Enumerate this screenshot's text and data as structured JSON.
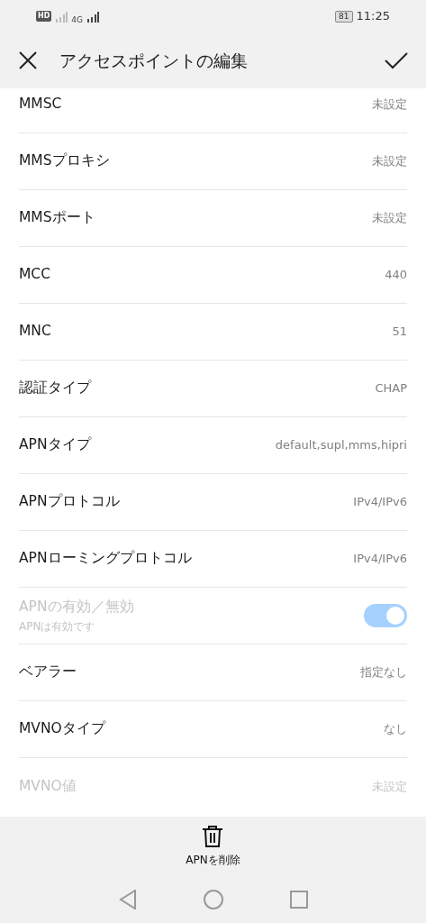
{
  "status_bar": {
    "hd_label": "HD",
    "network_label": "4G",
    "battery": "81",
    "time": "11:25"
  },
  "header": {
    "title": "アクセスポイントの編集"
  },
  "rows": [
    {
      "kind": "value",
      "label": "MMSC",
      "value": "未設定",
      "disabled": false
    },
    {
      "kind": "value",
      "label": "MMSプロキシ",
      "value": "未設定",
      "disabled": false
    },
    {
      "kind": "value",
      "label": "MMSポート",
      "value": "未設定",
      "disabled": false
    },
    {
      "kind": "value",
      "label": "MCC",
      "value": "440",
      "disabled": false
    },
    {
      "kind": "value",
      "label": "MNC",
      "value": "51",
      "disabled": false
    },
    {
      "kind": "value",
      "label": "認証タイプ",
      "value": "CHAP",
      "disabled": false
    },
    {
      "kind": "value",
      "label": "APNタイプ",
      "value": "default,supl,mms,hipri",
      "disabled": false
    },
    {
      "kind": "value",
      "label": "APNプロトコル",
      "value": "IPv4/IPv6",
      "disabled": false
    },
    {
      "kind": "value",
      "label": "APNローミングプロトコル",
      "value": "IPv4/IPv6",
      "disabled": false
    },
    {
      "kind": "toggle",
      "label": "APNの有効／無効",
      "summary": "APNは有効です",
      "on": true,
      "disabled": true
    },
    {
      "kind": "value",
      "label": "ベアラー",
      "value": "指定なし",
      "disabled": false
    },
    {
      "kind": "value",
      "label": "MVNOタイプ",
      "value": "なし",
      "disabled": false
    },
    {
      "kind": "value",
      "label": "MVNO値",
      "value": "未設定",
      "disabled": true
    }
  ],
  "footer": {
    "delete_label": "APNを削除"
  }
}
